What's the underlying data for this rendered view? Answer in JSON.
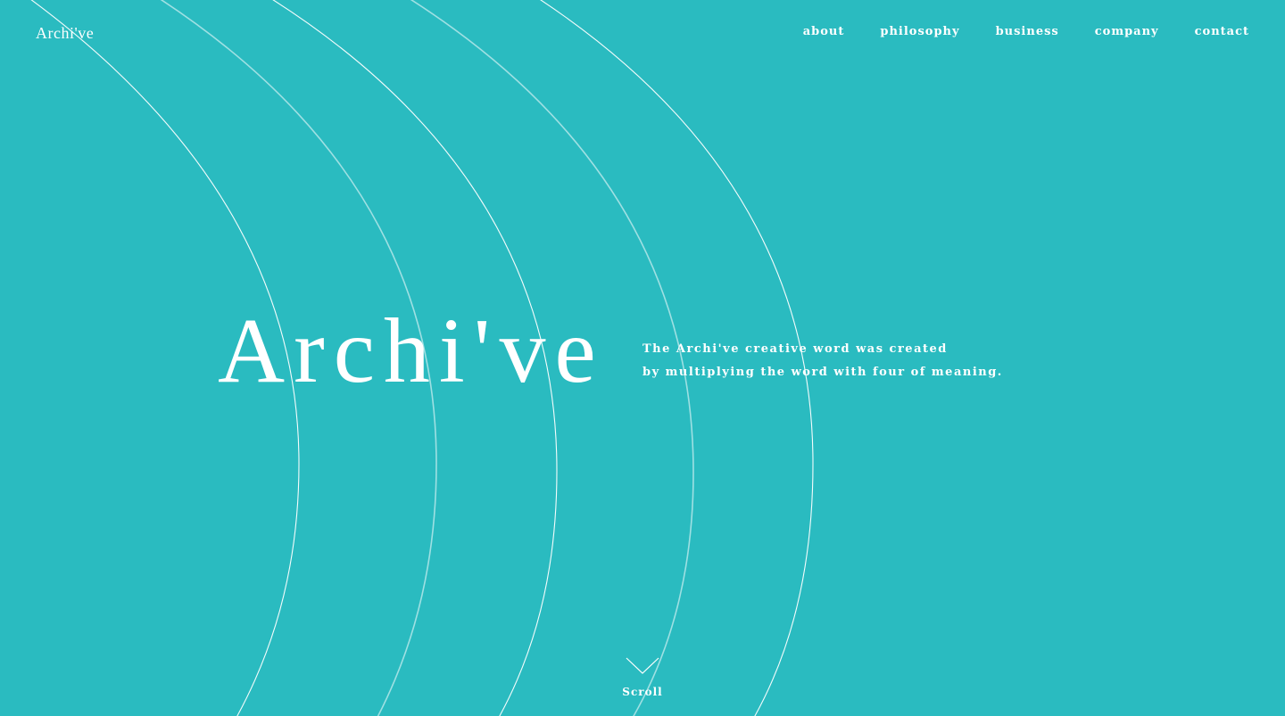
{
  "header": {
    "logo_text": "Archi've"
  },
  "nav": {
    "items": [
      {
        "label": "about"
      },
      {
        "label": "philosophy"
      },
      {
        "label": "business"
      },
      {
        "label": "company"
      },
      {
        "label": "contact"
      }
    ]
  },
  "hero": {
    "title": "Archi've",
    "tagline_line1": "The Archi've creative word was created",
    "tagline_line2": "by multiplying the word with four of meaning."
  },
  "scroll": {
    "label": "Scroll",
    "icon": "chevron-down-icon"
  },
  "colors": {
    "background": "#2abbc0",
    "foreground": "#ffffff"
  }
}
